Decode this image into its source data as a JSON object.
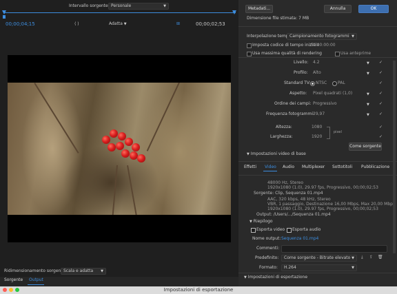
{
  "window": {
    "title": "Impostazioni di esportazione"
  },
  "left": {
    "tabs": [
      "Sorgente",
      "Output"
    ],
    "source_scaling": {
      "label": "Ridimensionamento sorgente:",
      "value": "Scala e adatta"
    },
    "timecode_left": "00;00;04;15",
    "timecode_right": "00;00;02;53",
    "fit": "Adatta",
    "source_range": {
      "label": "Intervallo sorgente:",
      "value": "Personale"
    }
  },
  "right": {
    "preset_section": "Impostazioni di esportazione",
    "format": {
      "label": "Formato:",
      "value": "H.264"
    },
    "preset": {
      "label": "Predefinito:",
      "value": "Come sorgente - Bitrate elevato"
    },
    "comment": {
      "label": "Commenti:",
      "value": ""
    },
    "output_name": {
      "label": "Nome output:",
      "value": "Sequenza 01.mp4"
    },
    "export_video": "Esporta video",
    "export_audio": "Esporta audio",
    "summary_label": "Riepilogo",
    "output_line": "Output: /Users/.../Sequenza 01.mp4",
    "output_details": [
      "1920x1080 (1.0), 29.97 fps, Progressivo, 00;00;02;53",
      "VBR, 1 passaggio, Destinazione 16,00 Mbps, Max 20,00 Mbps",
      "AAC, 320 kbps, 48 kHz, Stereo"
    ],
    "source_line": "Sorgente: Clip, Sequenza 01.mp4",
    "source_details": [
      "1920x1080 (1.0), 29.97 fps, Progressivo, 00;00;02;53",
      "48000 Hz, Stereo"
    ],
    "tabs": [
      "Effetti",
      "Video",
      "Audio",
      "Multiplexer",
      "Sottotitoli",
      "Pubblicazione"
    ],
    "video_section": "Impostazioni video di base",
    "match_source": "Come sorgente",
    "width": {
      "label": "Larghezza:",
      "value": "1920"
    },
    "height": {
      "label": "Altezza:",
      "value": "1080"
    },
    "px": "pixel",
    "fps": {
      "label": "Frequenza fotogrammi:",
      "value": "29,97"
    },
    "field_order": {
      "label": "Ordine dei campi:",
      "value": "Progressivo"
    },
    "aspect": {
      "label": "Aspetto:",
      "value": "Pixel quadrati (1,0)"
    },
    "tv_standard": {
      "label": "Standard TV:",
      "ntsc": "NTSC",
      "pal": "PAL"
    },
    "profile": {
      "label": "Profilo:",
      "value": "Alto"
    },
    "level": {
      "label": "Livello:",
      "value": "4.2"
    },
    "max_quality": "Usa massima qualità di rendering",
    "use_previews": "Usa anteprime",
    "set_start_timecode": "Imposta codice di tempo iniziale",
    "start_timecode_value": "00:00:00:00",
    "interpolation": {
      "label": "Interpolazione tempo:",
      "value": "Campionamento fotogrammi"
    },
    "file_size": "Dimensione file stimata: 7 MB",
    "metadata_btn": "Metadati...",
    "cancel_btn": "Annulla",
    "ok_btn": "OK"
  },
  "colors": {
    "accent": "#3d8ee0",
    "ok": "#3d6fb0"
  }
}
